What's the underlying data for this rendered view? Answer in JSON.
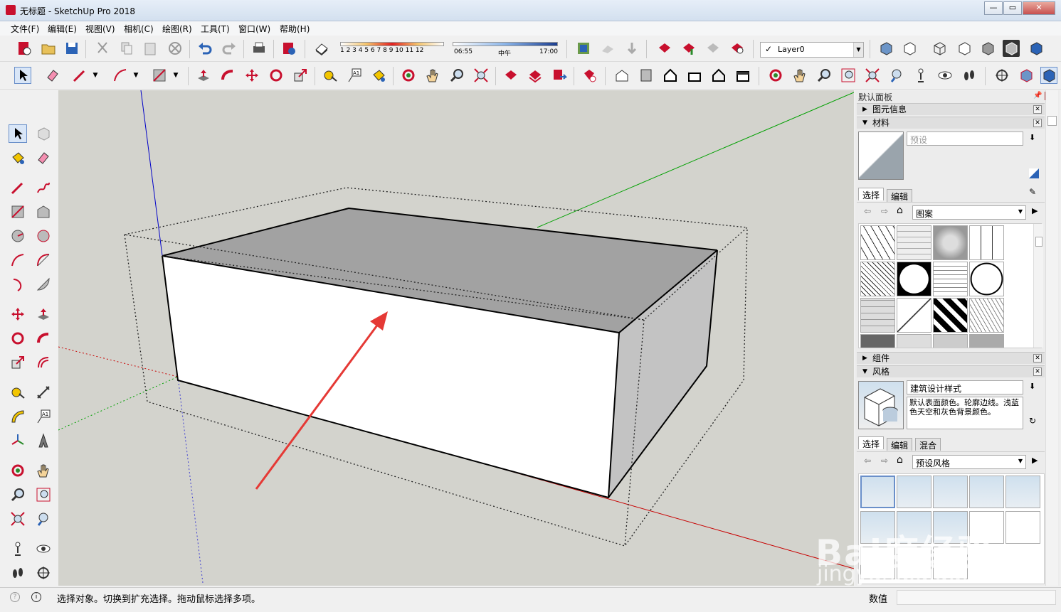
{
  "window": {
    "title": "无标题 - SketchUp Pro 2018",
    "min": "0",
    "max": "1",
    "close": "r"
  },
  "menu": [
    "文件(F)",
    "编辑(E)",
    "视图(V)",
    "相机(C)",
    "绘图(R)",
    "工具(T)",
    "窗口(W)",
    "帮助(H)"
  ],
  "shadow": {
    "months": "1 2 3 4 5 6 7 8 9 10 11 12",
    "time_start": "06:55",
    "time_mid": "中午",
    "time_end": "17:00"
  },
  "layer": {
    "check": "✓",
    "name": "Layer0"
  },
  "panel": {
    "title": "默认面板",
    "sections": {
      "entity_info": "图元信息",
      "materials": "材料",
      "components": "组件",
      "styles": "风格"
    },
    "materials": {
      "name_placeholder": "预设",
      "tab_select": "选择",
      "tab_edit": "编辑",
      "collection": "图案"
    },
    "styles": {
      "name": "建筑设计样式",
      "description": "默认表面颜色。轮廓边线。浅蓝色天空和灰色背景颜色。",
      "tab_select": "选择",
      "tab_edit": "编辑",
      "tab_mix": "混合",
      "collection": "预设风格"
    }
  },
  "status": {
    "message": "选择对象。切换到扩充选择。拖动鼠标选择多项。",
    "value_label": "数值"
  },
  "watermark": {
    "logo": "Bai度经验",
    "url": "jingyan.baidu.com"
  },
  "colors": {
    "accent_red": "#e53935",
    "sky": "#d3d3cd",
    "axis_red": "#c80000",
    "axis_green": "#00a000",
    "axis_blue": "#0000c8"
  }
}
